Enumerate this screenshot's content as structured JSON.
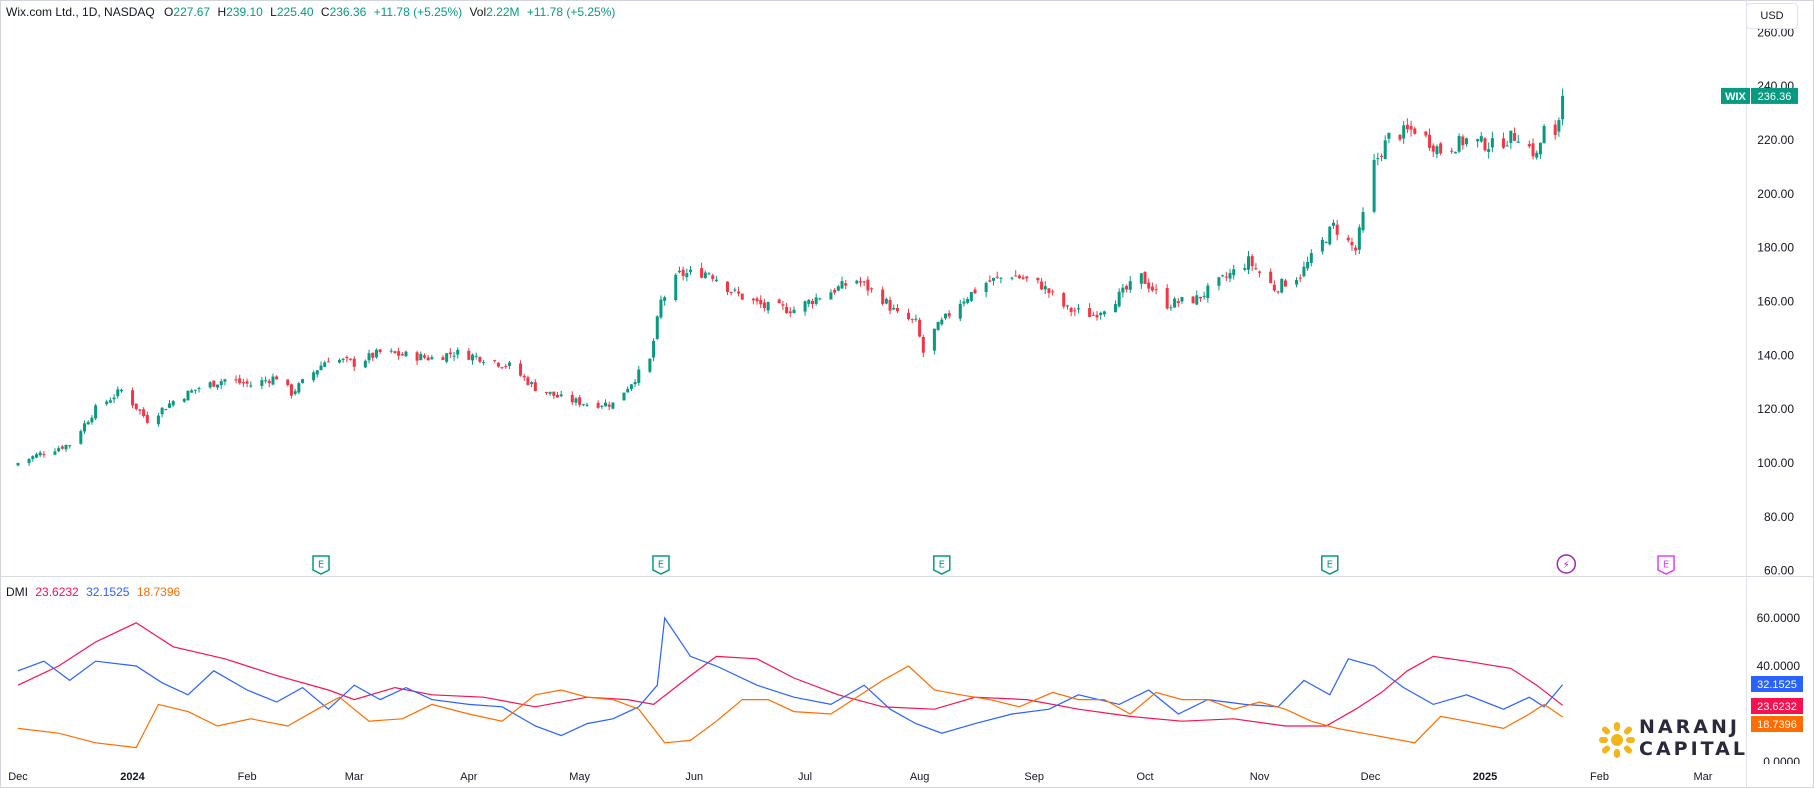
{
  "legend": {
    "symbol": "Wix.com Ltd., 1D, NASDAQ",
    "o_label": "O",
    "o": "227.67",
    "h_label": "H",
    "h": "239.10",
    "l_label": "L",
    "l": "225.40",
    "c_label": "C",
    "c": "236.36",
    "chg": "+11.78 (+5.25%)",
    "vol_label": "Vol",
    "vol": "2.22M",
    "vol_chg": "+11.78 (+5.25%)"
  },
  "currency": "USD",
  "price_tag": {
    "symbol": "WIX",
    "value": "236.36",
    "color": "#089981"
  },
  "dmi_legend": {
    "name": "DMI",
    "adx": "23.6232",
    "plus_di": "32.1525",
    "minus_di": "18.7396"
  },
  "dmi_tags": {
    "plus_di": "32.1525",
    "adx": "23.6232",
    "minus_di": "18.7396"
  },
  "colors": {
    "up": "#089981",
    "down": "#f23645",
    "plus_di": "#2962ff",
    "adx": "#f7124f",
    "minus_di": "#ff6d00",
    "event_green": "#089981",
    "event_purple": "#9c27b0",
    "event_pink": "#e040fb"
  },
  "logo": {
    "line1": "NARANJ",
    "line2": "CAPITAL"
  },
  "chart_data": [
    {
      "type": "candlestick",
      "title": "Wix.com Ltd., 1D, NASDAQ",
      "ylabel": "USD",
      "ylim": [
        58,
        272
      ],
      "y_ticks": [
        "260.00",
        "240.00",
        "220.00",
        "200.00",
        "180.00",
        "160.00",
        "140.00",
        "120.00",
        "100.00",
        "80.00",
        "60.00"
      ],
      "x_ticks": [
        "Dec",
        "2024",
        "Feb",
        "Mar",
        "Apr",
        "May",
        "Jun",
        "Jul",
        "Aug",
        "Sep",
        "Oct",
        "Nov",
        "Dec",
        "2025",
        "Feb",
        "Mar"
      ],
      "x_range": [
        "2023-12-01",
        "2025-03-25"
      ],
      "x_tick_dates": [
        "2023-12-01",
        "2024-01-01",
        "2024-02-01",
        "2024-03-01",
        "2024-04-01",
        "2024-05-01",
        "2024-06-01",
        "2024-07-01",
        "2024-08-01",
        "2024-09-01",
        "2024-10-01",
        "2024-11-01",
        "2024-12-01",
        "2025-01-01",
        "2025-02-01",
        "2025-03-01"
      ],
      "close_anchors": [
        [
          "2023-12-01",
          100
        ],
        [
          "2023-12-08",
          104
        ],
        [
          "2023-12-15",
          107
        ],
        [
          "2023-12-22",
          120
        ],
        [
          "2023-12-29",
          127
        ],
        [
          "2024-01-05",
          116
        ],
        [
          "2024-01-12",
          123
        ],
        [
          "2024-01-19",
          128
        ],
        [
          "2024-01-26",
          131
        ],
        [
          "2024-02-02",
          129
        ],
        [
          "2024-02-09",
          132
        ],
        [
          "2024-02-13",
          126
        ],
        [
          "2024-02-20",
          135
        ],
        [
          "2024-02-23",
          139
        ],
        [
          "2024-03-01",
          137
        ],
        [
          "2024-03-08",
          141
        ],
        [
          "2024-03-15",
          140
        ],
        [
          "2024-03-22",
          139
        ],
        [
          "2024-03-28",
          141
        ],
        [
          "2024-04-05",
          139
        ],
        [
          "2024-04-12",
          136
        ],
        [
          "2024-04-19",
          128
        ],
        [
          "2024-04-26",
          124
        ],
        [
          "2024-05-03",
          122
        ],
        [
          "2024-05-10",
          122
        ],
        [
          "2024-05-15",
          130
        ],
        [
          "2024-05-20",
          138
        ],
        [
          "2024-05-23",
          160
        ],
        [
          "2024-05-28",
          170
        ],
        [
          "2024-06-05",
          171
        ],
        [
          "2024-06-12",
          163
        ],
        [
          "2024-06-20",
          158
        ],
        [
          "2024-06-28",
          157
        ],
        [
          "2024-07-05",
          162
        ],
        [
          "2024-07-15",
          168
        ],
        [
          "2024-07-22",
          161
        ],
        [
          "2024-07-26",
          155
        ],
        [
          "2024-07-31",
          152
        ],
        [
          "2024-08-02",
          141
        ],
        [
          "2024-08-05",
          149
        ],
        [
          "2024-08-12",
          160
        ],
        [
          "2024-08-19",
          167
        ],
        [
          "2024-08-26",
          170
        ],
        [
          "2024-09-03",
          166
        ],
        [
          "2024-09-10",
          157
        ],
        [
          "2024-09-17",
          155
        ],
        [
          "2024-09-24",
          162
        ],
        [
          "2024-09-30",
          169
        ],
        [
          "2024-10-07",
          159
        ],
        [
          "2024-10-15",
          161
        ],
        [
          "2024-10-22",
          168
        ],
        [
          "2024-10-29",
          175
        ],
        [
          "2024-11-05",
          165
        ],
        [
          "2024-11-12",
          170
        ],
        [
          "2024-11-18",
          182
        ],
        [
          "2024-11-21",
          188
        ],
        [
          "2024-11-27",
          179
        ],
        [
          "2024-12-02",
          211
        ],
        [
          "2024-12-06",
          221
        ],
        [
          "2024-12-13",
          224
        ],
        [
          "2024-12-20",
          216
        ],
        [
          "2024-12-27",
          220
        ],
        [
          "2025-01-03",
          218
        ],
        [
          "2025-01-10",
          222
        ],
        [
          "2025-01-15",
          214
        ],
        [
          "2025-01-17",
          224
        ],
        [
          "2025-01-20",
          220
        ],
        [
          "2025-01-22",
          236.36
        ]
      ],
      "events": [
        {
          "date": "2024-02-21",
          "label": "E"
        },
        {
          "date": "2024-05-23",
          "label": "E"
        },
        {
          "date": "2024-08-07",
          "label": "E"
        },
        {
          "date": "2024-11-20",
          "label": "E"
        },
        {
          "date": "2025-01-23",
          "label": "⚡"
        },
        {
          "date": "2025-02-19",
          "label": "E"
        }
      ]
    },
    {
      "type": "line",
      "title": "DMI",
      "ylim": [
        0,
        60
      ],
      "y_ticks": [
        "60.0000",
        "40.0000",
        "0.0000"
      ],
      "series": [
        {
          "name": "ADX",
          "key": "adx",
          "points": [
            [
              "2023-12-01",
              32
            ],
            [
              "2023-12-12",
              40
            ],
            [
              "2023-12-22",
              50
            ],
            [
              "2024-01-02",
              58
            ],
            [
              "2024-01-12",
              48
            ],
            [
              "2024-01-26",
              43
            ],
            [
              "2024-02-09",
              36
            ],
            [
              "2024-02-23",
              30
            ],
            [
              "2024-03-01",
              26
            ],
            [
              "2024-03-12",
              31
            ],
            [
              "2024-03-22",
              28
            ],
            [
              "2024-04-05",
              27
            ],
            [
              "2024-04-19",
              23
            ],
            [
              "2024-05-03",
              27
            ],
            [
              "2024-05-14",
              26
            ],
            [
              "2024-05-21",
              24
            ],
            [
              "2024-05-31",
              36
            ],
            [
              "2024-06-07",
              44
            ],
            [
              "2024-06-18",
              43
            ],
            [
              "2024-06-28",
              35
            ],
            [
              "2024-07-10",
              28
            ],
            [
              "2024-07-22",
              23
            ],
            [
              "2024-08-05",
              22
            ],
            [
              "2024-08-16",
              27
            ],
            [
              "2024-08-30",
              26
            ],
            [
              "2024-09-13",
              22
            ],
            [
              "2024-09-27",
              19
            ],
            [
              "2024-10-11",
              17
            ],
            [
              "2024-10-25",
              18
            ],
            [
              "2024-11-08",
              15
            ],
            [
              "2024-11-19",
              15
            ],
            [
              "2024-11-27",
              22
            ],
            [
              "2024-12-04",
              29
            ],
            [
              "2024-12-11",
              38
            ],
            [
              "2024-12-18",
              44
            ],
            [
              "2024-12-27",
              42
            ],
            [
              "2025-01-08",
              39
            ],
            [
              "2025-01-15",
              32
            ],
            [
              "2025-01-22",
              23.6232
            ]
          ]
        },
        {
          "name": "+DI",
          "key": "plus_di",
          "points": [
            [
              "2023-12-01",
              38
            ],
            [
              "2023-12-08",
              42
            ],
            [
              "2023-12-15",
              34
            ],
            [
              "2023-12-22",
              42
            ],
            [
              "2024-01-02",
              40
            ],
            [
              "2024-01-09",
              33
            ],
            [
              "2024-01-16",
              28
            ],
            [
              "2024-01-23",
              38
            ],
            [
              "2024-02-01",
              30
            ],
            [
              "2024-02-09",
              25
            ],
            [
              "2024-02-16",
              31
            ],
            [
              "2024-02-23",
              22
            ],
            [
              "2024-03-01",
              32
            ],
            [
              "2024-03-08",
              26
            ],
            [
              "2024-03-15",
              31
            ],
            [
              "2024-03-22",
              26
            ],
            [
              "2024-04-01",
              24
            ],
            [
              "2024-04-10",
              23
            ],
            [
              "2024-04-19",
              15
            ],
            [
              "2024-04-26",
              11
            ],
            [
              "2024-05-03",
              16
            ],
            [
              "2024-05-10",
              18
            ],
            [
              "2024-05-17",
              23
            ],
            [
              "2024-05-22",
              32
            ],
            [
              "2024-05-24",
              60
            ],
            [
              "2024-05-31",
              44
            ],
            [
              "2024-06-07",
              40
            ],
            [
              "2024-06-18",
              32
            ],
            [
              "2024-06-28",
              27
            ],
            [
              "2024-07-08",
              24
            ],
            [
              "2024-07-17",
              32
            ],
            [
              "2024-07-24",
              22
            ],
            [
              "2024-07-31",
              16
            ],
            [
              "2024-08-07",
              12
            ],
            [
              "2024-08-16",
              16
            ],
            [
              "2024-08-26",
              20
            ],
            [
              "2024-09-05",
              22
            ],
            [
              "2024-09-13",
              28
            ],
            [
              "2024-09-24",
              24
            ],
            [
              "2024-10-02",
              30
            ],
            [
              "2024-10-10",
              20
            ],
            [
              "2024-10-18",
              26
            ],
            [
              "2024-10-28",
              24
            ],
            [
              "2024-11-06",
              23
            ],
            [
              "2024-11-13",
              34
            ],
            [
              "2024-11-20",
              28
            ],
            [
              "2024-11-25",
              43
            ],
            [
              "2024-12-02",
              40
            ],
            [
              "2024-12-10",
              31
            ],
            [
              "2024-12-18",
              24
            ],
            [
              "2024-12-27",
              28
            ],
            [
              "2025-01-06",
              22
            ],
            [
              "2025-01-13",
              27
            ],
            [
              "2025-01-17",
              23
            ],
            [
              "2025-01-22",
              32.1525
            ]
          ]
        },
        {
          "name": "-DI",
          "key": "minus_di",
          "points": [
            [
              "2023-12-01",
              14
            ],
            [
              "2023-12-12",
              12
            ],
            [
              "2023-12-22",
              8
            ],
            [
              "2024-01-02",
              6
            ],
            [
              "2024-01-08",
              24
            ],
            [
              "2024-01-16",
              21
            ],
            [
              "2024-01-24",
              15
            ],
            [
              "2024-02-02",
              18
            ],
            [
              "2024-02-12",
              15
            ],
            [
              "2024-02-20",
              22
            ],
            [
              "2024-02-26",
              27
            ],
            [
              "2024-03-05",
              17
            ],
            [
              "2024-03-14",
              18
            ],
            [
              "2024-03-22",
              24
            ],
            [
              "2024-04-01",
              20
            ],
            [
              "2024-04-10",
              17
            ],
            [
              "2024-04-19",
              28
            ],
            [
              "2024-04-26",
              30
            ],
            [
              "2024-05-03",
              27
            ],
            [
              "2024-05-10",
              26
            ],
            [
              "2024-05-17",
              22
            ],
            [
              "2024-05-24",
              8
            ],
            [
              "2024-05-31",
              9
            ],
            [
              "2024-06-07",
              17
            ],
            [
              "2024-06-14",
              26
            ],
            [
              "2024-06-21",
              26
            ],
            [
              "2024-06-28",
              21
            ],
            [
              "2024-07-08",
              20
            ],
            [
              "2024-07-15",
              27
            ],
            [
              "2024-07-22",
              34
            ],
            [
              "2024-07-29",
              40
            ],
            [
              "2024-08-05",
              30
            ],
            [
              "2024-08-12",
              28
            ],
            [
              "2024-08-20",
              26
            ],
            [
              "2024-08-28",
              23
            ],
            [
              "2024-09-06",
              29
            ],
            [
              "2024-09-13",
              26
            ],
            [
              "2024-09-20",
              26
            ],
            [
              "2024-09-27",
              20
            ],
            [
              "2024-10-04",
              29
            ],
            [
              "2024-10-11",
              26
            ],
            [
              "2024-10-18",
              26
            ],
            [
              "2024-10-25",
              22
            ],
            [
              "2024-11-01",
              25
            ],
            [
              "2024-11-08",
              22
            ],
            [
              "2024-11-15",
              17
            ],
            [
              "2024-11-22",
              14
            ],
            [
              "2024-11-29",
              12
            ],
            [
              "2024-12-06",
              10
            ],
            [
              "2024-12-13",
              8
            ],
            [
              "2024-12-20",
              19
            ],
            [
              "2024-12-27",
              17
            ],
            [
              "2025-01-06",
              14
            ],
            [
              "2025-01-13",
              20
            ],
            [
              "2025-01-17",
              24
            ],
            [
              "2025-01-22",
              18.7396
            ]
          ]
        }
      ]
    }
  ]
}
